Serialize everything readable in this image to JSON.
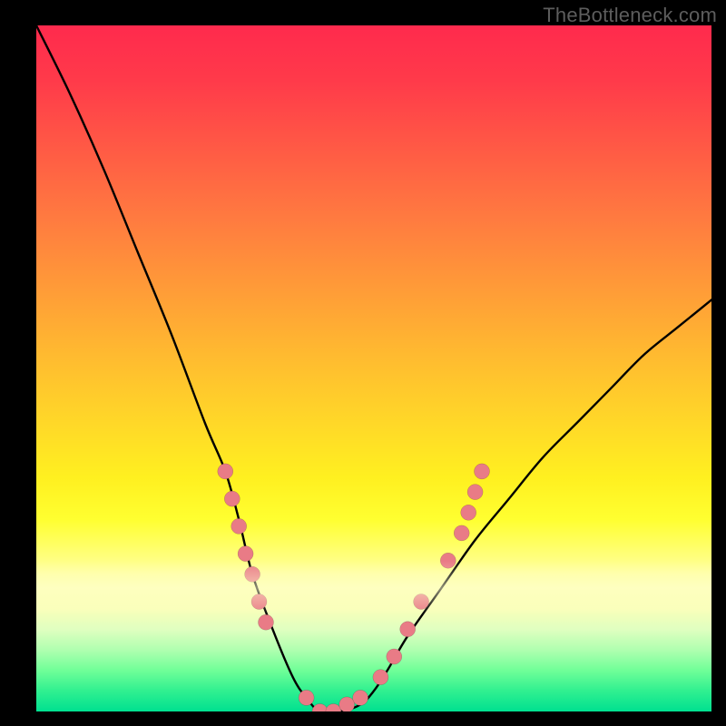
{
  "watermark": "TheBottleneck.com",
  "chart_data": {
    "type": "line",
    "title": "",
    "xlabel": "",
    "ylabel": "",
    "xlim": [
      0,
      100
    ],
    "ylim": [
      0,
      100
    ],
    "grid": false,
    "background": "rainbow-gradient-vertical",
    "series": [
      {
        "name": "bottleneck-curve",
        "x": [
          0,
          5,
          10,
          15,
          20,
          25,
          28,
          30,
          32,
          35,
          38,
          40,
          42,
          45,
          48,
          50,
          52,
          55,
          60,
          65,
          70,
          75,
          80,
          85,
          90,
          95,
          100
        ],
        "y": [
          100,
          90,
          79,
          67,
          55,
          42,
          35,
          28,
          20,
          12,
          5,
          2,
          0,
          0,
          1,
          3,
          6,
          11,
          18,
          25,
          31,
          37,
          42,
          47,
          52,
          56,
          60
        ]
      }
    ],
    "markers": {
      "name": "highlight-dots",
      "color": "#e97b86",
      "points": [
        {
          "x": 28,
          "y": 35
        },
        {
          "x": 29,
          "y": 31
        },
        {
          "x": 30,
          "y": 27
        },
        {
          "x": 31,
          "y": 23
        },
        {
          "x": 32,
          "y": 20
        },
        {
          "x": 33,
          "y": 16
        },
        {
          "x": 34,
          "y": 13
        },
        {
          "x": 40,
          "y": 2
        },
        {
          "x": 42,
          "y": 0
        },
        {
          "x": 44,
          "y": 0
        },
        {
          "x": 46,
          "y": 1
        },
        {
          "x": 48,
          "y": 2
        },
        {
          "x": 51,
          "y": 5
        },
        {
          "x": 53,
          "y": 8
        },
        {
          "x": 55,
          "y": 12
        },
        {
          "x": 57,
          "y": 16
        },
        {
          "x": 61,
          "y": 22
        },
        {
          "x": 63,
          "y": 26
        },
        {
          "x": 64,
          "y": 29
        },
        {
          "x": 65,
          "y": 32
        },
        {
          "x": 66,
          "y": 35
        }
      ]
    }
  }
}
